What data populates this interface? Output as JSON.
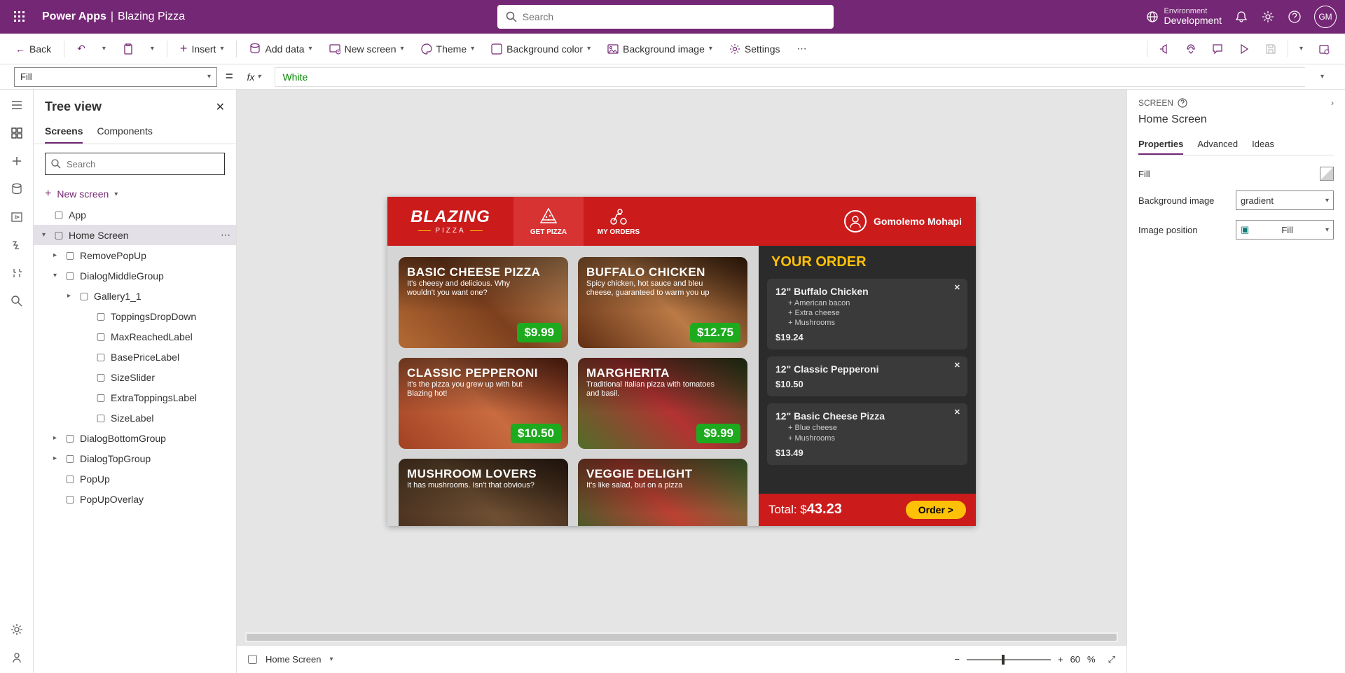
{
  "topbar": {
    "app": "Power Apps",
    "doc": "Blazing Pizza",
    "search_placeholder": "Search",
    "env_label": "Environment",
    "env_value": "Development",
    "user_initials": "GM"
  },
  "ribbon": {
    "back": "Back",
    "insert": "Insert",
    "add_data": "Add data",
    "new_screen": "New screen",
    "theme": "Theme",
    "bg_color": "Background color",
    "bg_image": "Background image",
    "settings": "Settings"
  },
  "formula": {
    "property": "Fill",
    "value": "White"
  },
  "tree": {
    "title": "Tree view",
    "tab_screens": "Screens",
    "tab_components": "Components",
    "search_placeholder": "Search",
    "new_screen": "New screen",
    "items": [
      {
        "label": "App",
        "depth": 0,
        "icon": "app",
        "toggle": ""
      },
      {
        "label": "Home Screen",
        "depth": 0,
        "icon": "screen",
        "toggle": "▾",
        "selected": true
      },
      {
        "label": "RemovePopUp",
        "depth": 1,
        "icon": "group",
        "toggle": "▸"
      },
      {
        "label": "DialogMiddleGroup",
        "depth": 1,
        "icon": "group",
        "toggle": "▾"
      },
      {
        "label": "Gallery1_1",
        "depth": 2,
        "icon": "gallery",
        "toggle": "▸"
      },
      {
        "label": "ToppingsDropDown",
        "depth": 3,
        "icon": "dropdown",
        "toggle": ""
      },
      {
        "label": "MaxReachedLabel",
        "depth": 3,
        "icon": "label",
        "toggle": ""
      },
      {
        "label": "BasePriceLabel",
        "depth": 3,
        "icon": "label",
        "toggle": ""
      },
      {
        "label": "SizeSlider",
        "depth": 3,
        "icon": "slider",
        "toggle": ""
      },
      {
        "label": "ExtraToppingsLabel",
        "depth": 3,
        "icon": "label",
        "toggle": ""
      },
      {
        "label": "SizeLabel",
        "depth": 3,
        "icon": "label",
        "toggle": ""
      },
      {
        "label": "DialogBottomGroup",
        "depth": 1,
        "icon": "group",
        "toggle": "▸"
      },
      {
        "label": "DialogTopGroup",
        "depth": 1,
        "icon": "group",
        "toggle": "▸"
      },
      {
        "label": "PopUp",
        "depth": 1,
        "icon": "popup",
        "toggle": ""
      },
      {
        "label": "PopUpOverlay",
        "depth": 1,
        "icon": "popup",
        "toggle": ""
      }
    ]
  },
  "canvas": {
    "logo_big": "BLAZING",
    "logo_small": "PIZZA",
    "tab_get": "GET PIZZA",
    "tab_orders": "MY ORDERS",
    "user": "Gomolemo Mohapi",
    "pizzas": [
      {
        "name": "BASIC CHEESE PIZZA",
        "desc": "It's cheesy and delicious. Why wouldn't you want one?",
        "price": "$9.99",
        "bg": "bg1"
      },
      {
        "name": "BUFFALO CHICKEN",
        "desc": "Spicy chicken, hot sauce and bleu cheese, guaranteed to warm you up",
        "price": "$12.75",
        "bg": "bg2"
      },
      {
        "name": "CLASSIC PEPPERONI",
        "desc": "It's the pizza you grew up with but Blazing hot!",
        "price": "$10.50",
        "bg": "bg3"
      },
      {
        "name": "MARGHERITA",
        "desc": "Traditional Italian pizza with tomatoes and basil.",
        "price": "$9.99",
        "bg": "bg4"
      },
      {
        "name": "MUSHROOM LOVERS",
        "desc": "It has mushrooms. Isn't that obvious?",
        "price": "",
        "bg": "bg5"
      },
      {
        "name": "VEGGIE DELIGHT",
        "desc": "It's like salad, but on a pizza",
        "price": "",
        "bg": "bg6"
      }
    ],
    "order_title": "YOUR ORDER",
    "orders": [
      {
        "title": "12\" Buffalo Chicken",
        "tops": [
          "+ American bacon",
          "+ Extra cheese",
          "+ Mushrooms"
        ],
        "price": "$19.24"
      },
      {
        "title": "12\" Classic Pepperoni",
        "tops": [],
        "price": "$10.50"
      },
      {
        "title": "12\" Basic Cheese Pizza",
        "tops": [
          "+ Blue cheese",
          "+ Mushrooms"
        ],
        "price": "$13.49"
      }
    ],
    "total_label": "Total: $",
    "total_value": "43.23",
    "order_btn": "Order >",
    "footer_screen": "Home Screen",
    "zoom": "60",
    "zoom_unit": "%"
  },
  "props": {
    "head": "SCREEN",
    "title": "Home Screen",
    "tab_props": "Properties",
    "tab_adv": "Advanced",
    "tab_ideas": "Ideas",
    "rows": [
      {
        "label": "Fill",
        "type": "swatch"
      },
      {
        "label": "Background image",
        "type": "select",
        "value": "gradient"
      },
      {
        "label": "Image position",
        "type": "select",
        "value": "Fill",
        "icon": true
      }
    ]
  }
}
